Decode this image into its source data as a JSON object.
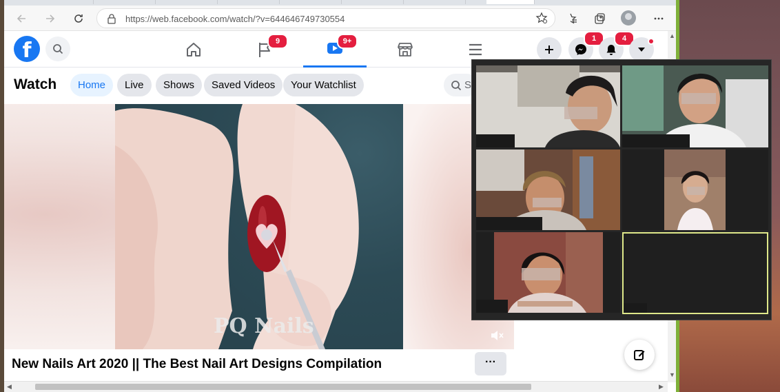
{
  "browser": {
    "url": "https://web.facebook.com/watch/?v=644646749730554",
    "icons": [
      "back-icon",
      "forward-icon",
      "refresh-icon",
      "lock-icon",
      "star-icon",
      "favorites-icon",
      "collections-icon",
      "profile-icon",
      "more-icon"
    ]
  },
  "facebook": {
    "badges": {
      "pages": "9",
      "watch": "9+",
      "messenger": "1",
      "notifications": "4"
    },
    "accent": "#1877f2",
    "badge_color": "#e41e3f"
  },
  "watch": {
    "title": "Watch",
    "tabs": [
      {
        "label": "Home",
        "active": true
      },
      {
        "label": "Live",
        "active": false
      },
      {
        "label": "Shows",
        "active": false
      },
      {
        "label": "Saved Videos",
        "active": false
      },
      {
        "label": "Your Watchlist",
        "active": false
      }
    ],
    "search_placeholder": "Se"
  },
  "video": {
    "watermark": "PQ Nails",
    "title": "New Nails Art 2020 || The Best Nail Art Designs Compilation",
    "more_label": "···"
  },
  "call": {
    "participants": 5,
    "selected_tile_color": "#dfe88a"
  }
}
